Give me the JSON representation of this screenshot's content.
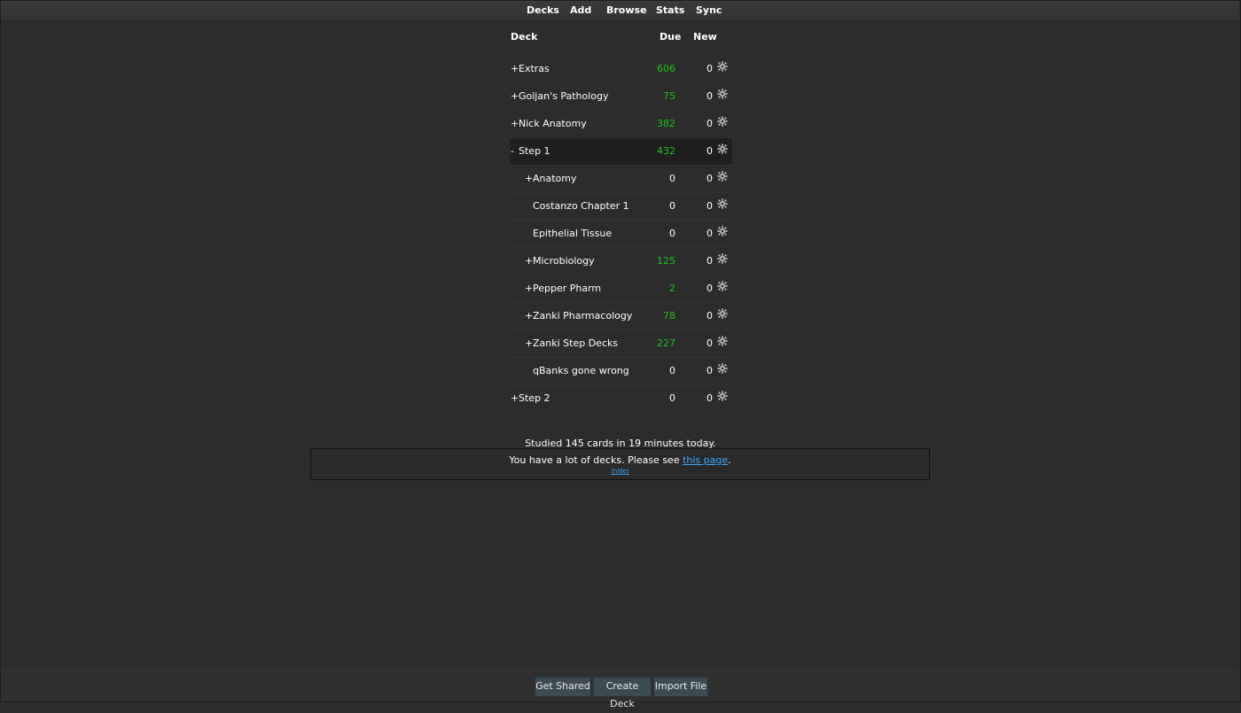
{
  "nav": {
    "decks": "Decks",
    "add": "Add",
    "browse": "Browse",
    "stats": "Stats",
    "sync": "Sync"
  },
  "table_header": {
    "deck": "Deck",
    "due": "Due",
    "new": "New"
  },
  "decks": [
    {
      "prefix": "+",
      "name": "Extras",
      "due": "606",
      "new": "0"
    },
    {
      "prefix": "+",
      "name": "Goljan's Pathology",
      "due": "75",
      "new": "0"
    },
    {
      "prefix": "+",
      "name": "Nick Anatomy",
      "due": "382",
      "new": "0"
    },
    {
      "prefix": "-",
      "name": "Step 1",
      "due": "432",
      "new": "0"
    },
    {
      "prefix": "+",
      "name": "Anatomy",
      "due": "0",
      "new": "0"
    },
    {
      "prefix": "",
      "name": "Costanzo Chapter 1",
      "due": "0",
      "new": "0"
    },
    {
      "prefix": "",
      "name": "Epithelial Tissue",
      "due": "0",
      "new": "0"
    },
    {
      "prefix": "+",
      "name": "Microbiology",
      "due": "125",
      "new": "0"
    },
    {
      "prefix": "+",
      "name": "Pepper Pharm",
      "due": "2",
      "new": "0"
    },
    {
      "prefix": "+",
      "name": "Zanki Pharmacology",
      "due": "78",
      "new": "0"
    },
    {
      "prefix": "+",
      "name": "Zanki Step Decks",
      "due": "227",
      "new": "0"
    },
    {
      "prefix": "",
      "name": "qBanks gone wrong",
      "due": "0",
      "new": "0"
    },
    {
      "prefix": "+",
      "name": "Step 2",
      "due": "0",
      "new": "0"
    }
  ],
  "studied_text": "Studied 145 cards in 19 minutes today.",
  "notice": {
    "text_before": "You have a lot of decks. Please see ",
    "link": "this page",
    "text_after": ".",
    "hide": "(hide)"
  },
  "bottom_buttons": {
    "get_shared": "Get Shared",
    "create_deck": "Create Deck",
    "import_file": "Import File"
  },
  "colors": {
    "due_green": "#1ec21e",
    "link": "#3aa6ff",
    "button_bg": "#3c4b51"
  },
  "icons": {
    "row_options": "gear-icon"
  }
}
